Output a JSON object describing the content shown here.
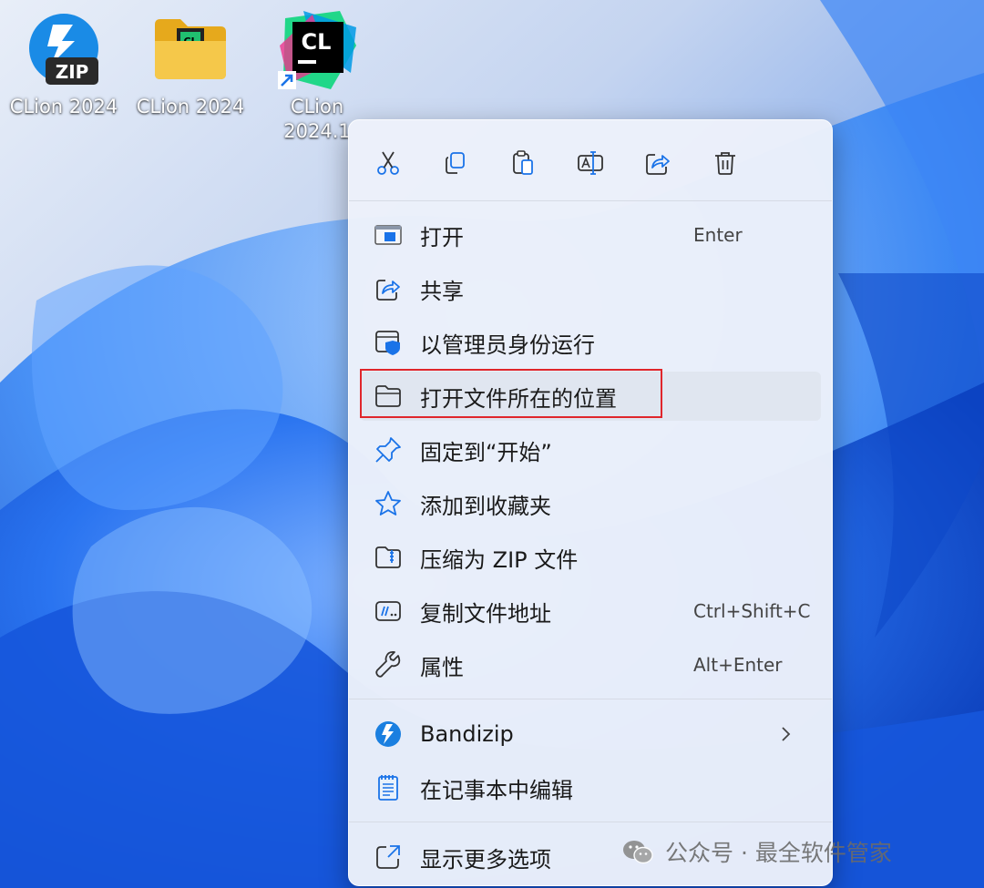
{
  "desktop": {
    "icons": [
      {
        "label": "CLion 2024",
        "type": "zip",
        "badge": "ZIP"
      },
      {
        "label": "CLion 2024",
        "type": "folder",
        "badge": "CL"
      },
      {
        "label": "CLion\n2024.1",
        "type": "shortcut",
        "badge": "CL"
      }
    ]
  },
  "menu": {
    "toolbar": [
      {
        "name": "cut",
        "icon": "scissors-icon"
      },
      {
        "name": "copy",
        "icon": "copy-icon"
      },
      {
        "name": "paste",
        "icon": "paste-icon"
      },
      {
        "name": "rename",
        "icon": "rename-icon"
      },
      {
        "name": "share",
        "icon": "share-icon"
      },
      {
        "name": "delete",
        "icon": "trash-icon"
      }
    ],
    "items": [
      {
        "label": "打开",
        "shortcut": "Enter",
        "icon": "window-icon"
      },
      {
        "label": "共享",
        "shortcut": "",
        "icon": "share-icon"
      },
      {
        "label": "以管理员身份运行",
        "shortcut": "",
        "icon": "shield-window-icon"
      },
      {
        "label": "打开文件所在的位置",
        "shortcut": "",
        "icon": "folder-icon"
      },
      {
        "label": "固定到“开始”",
        "shortcut": "",
        "icon": "pin-icon"
      },
      {
        "label": "添加到收藏夹",
        "shortcut": "",
        "icon": "star-icon"
      },
      {
        "label": "压缩为 ZIP 文件",
        "shortcut": "",
        "icon": "zip-folder-icon"
      },
      {
        "label": "复制文件地址",
        "shortcut": "Ctrl+Shift+C",
        "icon": "path-icon"
      },
      {
        "label": "属性",
        "shortcut": "Alt+Enter",
        "icon": "wrench-icon"
      },
      {
        "label": "Bandizip",
        "shortcut": "",
        "icon": "bandizip-icon",
        "submenu": true
      },
      {
        "label": "在记事本中编辑",
        "shortcut": "",
        "icon": "notepad-icon"
      },
      {
        "label": "显示更多选项",
        "shortcut": "",
        "icon": "more-options-icon"
      }
    ]
  },
  "watermark": {
    "text": "公众号 · 最全软件管家"
  },
  "colors": {
    "accent": "#1a73e8",
    "highlight_border": "#e0262b"
  }
}
